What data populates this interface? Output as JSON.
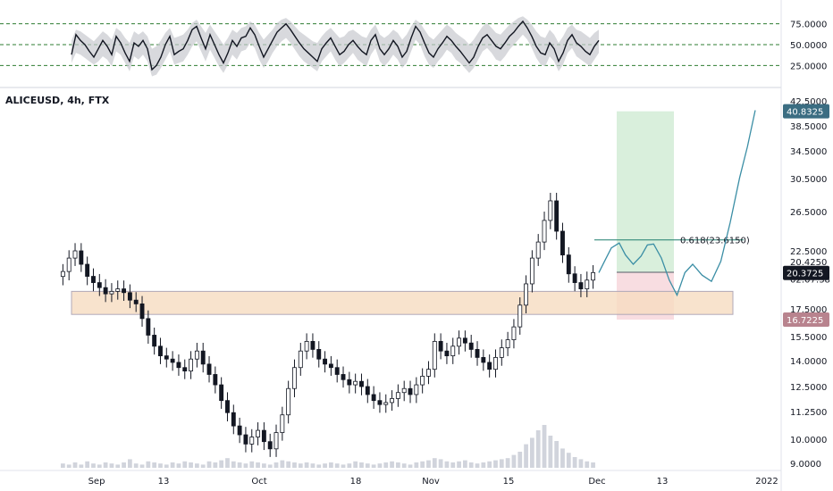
{
  "header": {
    "symbol_title": "ALICEUSD, 4h, FTX"
  },
  "colors": {
    "up_candle": "#131722",
    "volume": "#d1d4dc",
    "rsi_line": "#131722",
    "rsi_band": "#c7c9ce",
    "rsi_dash": "#2e7d32",
    "zone_fill": "#f6dcc0",
    "zone_stroke": "#b0a8b8",
    "target_fill": "#d9efdc",
    "stop_fill": "#f8dde1",
    "projection": "#3b8ea5",
    "fib_line": "#1f7f6e",
    "last_price_tag": "#131722",
    "target_tag": "#3b6d82",
    "stop_tag": "#b8838e"
  },
  "chart_data": [
    {
      "type": "line",
      "name": "rsi-pane",
      "y_ticks": [
        "75.0000",
        "50.0000",
        "25.0000"
      ],
      "y_tick_values": [
        75,
        50,
        25
      ],
      "ylim": [
        5,
        95
      ],
      "dashed_levels": [
        75,
        50,
        25
      ],
      "x": [
        0,
        5,
        10,
        15,
        20,
        25,
        30,
        35,
        40,
        45,
        50,
        55,
        60,
        65,
        70,
        75,
        80,
        85,
        90,
        95,
        100,
        105,
        110,
        115,
        120,
        125,
        130,
        135,
        140,
        145,
        150,
        155,
        160,
        165,
        170,
        175,
        180,
        185,
        190,
        195,
        200,
        205,
        210,
        215,
        220,
        225,
        230,
        235,
        240,
        245,
        250,
        255,
        260,
        265,
        270,
        275,
        280,
        285,
        290,
        295,
        300,
        305,
        310,
        315,
        320,
        325,
        330,
        335,
        340,
        345,
        350,
        355,
        360,
        365,
        370,
        375,
        380,
        385,
        390,
        395,
        400,
        405,
        410,
        415,
        420,
        425,
        430,
        435,
        440,
        445,
        450,
        455,
        460,
        465,
        470,
        475,
        480,
        485,
        490,
        495,
        500,
        505,
        510,
        515,
        520,
        525,
        530,
        535,
        540,
        545,
        550,
        555,
        560,
        565,
        570,
        575,
        580,
        585,
        590
      ],
      "values": [
        38,
        62,
        55,
        50,
        42,
        35,
        45,
        55,
        48,
        38,
        60,
        52,
        40,
        30,
        52,
        48,
        55,
        45,
        20,
        25,
        35,
        50,
        60,
        38,
        42,
        45,
        55,
        68,
        72,
        58,
        45,
        62,
        50,
        38,
        28,
        40,
        55,
        48,
        58,
        60,
        70,
        62,
        48,
        35,
        45,
        55,
        65,
        70,
        75,
        68,
        60,
        52,
        45,
        40,
        35,
        30,
        45,
        52,
        58,
        48,
        38,
        42,
        50,
        55,
        48,
        42,
        38,
        55,
        62,
        45,
        38,
        45,
        55,
        48,
        35,
        42,
        58,
        72,
        65,
        52,
        40,
        35,
        45,
        52,
        60,
        55,
        48,
        42,
        35,
        28,
        35,
        48,
        58,
        62,
        55,
        48,
        45,
        52,
        60,
        65,
        72,
        78,
        70,
        60,
        48,
        40,
        38,
        52,
        45,
        30,
        40,
        55,
        62,
        52,
        48,
        42,
        38,
        48,
        55
      ],
      "band_upper": [
        55,
        68,
        66,
        62,
        58,
        54,
        60,
        66,
        62,
        56,
        70,
        66,
        58,
        52,
        66,
        62,
        66,
        60,
        45,
        48,
        55,
        64,
        70,
        58,
        60,
        62,
        68,
        76,
        80,
        72,
        64,
        74,
        66,
        58,
        50,
        58,
        68,
        64,
        70,
        72,
        78,
        74,
        64,
        56,
        62,
        68,
        76,
        80,
        82,
        78,
        72,
        66,
        62,
        58,
        54,
        52,
        60,
        66,
        70,
        64,
        58,
        60,
        66,
        68,
        64,
        60,
        58,
        68,
        74,
        62,
        58,
        62,
        68,
        64,
        56,
        62,
        72,
        80,
        76,
        68,
        60,
        56,
        62,
        68,
        74,
        70,
        64,
        60,
        56,
        50,
        56,
        64,
        72,
        76,
        70,
        64,
        62,
        68,
        74,
        78,
        82,
        84,
        80,
        74,
        66,
        60,
        58,
        68,
        62,
        52,
        60,
        70,
        74,
        68,
        66,
        62,
        58,
        64,
        68
      ],
      "band_lower": [
        28,
        40,
        38,
        34,
        30,
        26,
        30,
        36,
        32,
        24,
        42,
        38,
        28,
        18,
        36,
        32,
        38,
        30,
        12,
        14,
        22,
        32,
        42,
        26,
        28,
        30,
        38,
        48,
        54,
        42,
        30,
        44,
        34,
        24,
        16,
        26,
        38,
        32,
        42,
        44,
        52,
        46,
        32,
        22,
        30,
        40,
        48,
        54,
        58,
        52,
        44,
        36,
        30,
        26,
        22,
        18,
        30,
        36,
        42,
        32,
        24,
        28,
        34,
        40,
        32,
        28,
        24,
        38,
        46,
        30,
        24,
        30,
        38,
        32,
        22,
        28,
        42,
        56,
        50,
        36,
        26,
        22,
        30,
        36,
        44,
        40,
        32,
        28,
        22,
        16,
        22,
        32,
        42,
        46,
        40,
        32,
        30,
        36,
        44,
        50,
        56,
        62,
        56,
        46,
        34,
        26,
        24,
        36,
        30,
        18,
        26,
        40,
        46,
        36,
        32,
        28,
        24,
        32,
        40
      ]
    },
    {
      "type": "candlestick",
      "name": "price-pane",
      "title": "ALICEUSD, 4h, FTX",
      "x_ticks": [
        "Sep",
        "13",
        "Oct",
        "18",
        "Nov",
        "15",
        "Dec",
        "13",
        "2022"
      ],
      "y_ticks": [
        "42.5000",
        "38.5000",
        "34.5000",
        "30.5000",
        "26.5000",
        "22.5000",
        "20.4250",
        "17.5000",
        "15.5000",
        "14.0000",
        "12.5000",
        "11.2500",
        "10.0000",
        "9.0000"
      ],
      "y_tick_values": [
        42.5,
        38.5,
        34.5,
        30.5,
        26.5,
        22.5,
        20.425,
        17.5,
        15.5,
        14,
        12.5,
        11.25,
        10,
        9
      ],
      "closes": [
        20.5,
        21.8,
        22.5,
        21.2,
        20.1,
        19.6,
        19.2,
        18.7,
        18.9,
        19.1,
        18.8,
        18.2,
        17.9,
        16.8,
        15.6,
        14.9,
        14.3,
        14.1,
        13.9,
        13.6,
        13.4,
        14.1,
        14.6,
        13.8,
        13.2,
        12.6,
        11.8,
        11.2,
        10.6,
        10.2,
        9.8,
        10.1,
        10.4,
        9.9,
        9.6,
        10.3,
        11.1,
        12.4,
        13.6,
        14.6,
        15.2,
        14.7,
        14.1,
        13.8,
        13.6,
        13.2,
        12.9,
        12.6,
        12.8,
        12.5,
        12.1,
        11.8,
        11.6,
        11.7,
        11.9,
        12.2,
        12.4,
        12.1,
        12.6,
        13.1,
        13.5,
        15.2,
        14.6,
        14.3,
        14.9,
        15.4,
        15.1,
        14.7,
        14.2,
        13.9,
        13.5,
        14.2,
        14.8,
        15.3,
        16.2,
        17.8,
        19.5,
        21.8,
        23.4,
        25.6,
        27.8,
        24.5,
        22.1,
        20.3,
        19.6,
        19.1,
        19.8,
        20.4
      ],
      "volumes": [
        4,
        3,
        5,
        3,
        6,
        4,
        3,
        5,
        4,
        3,
        5,
        8,
        4,
        3,
        6,
        5,
        4,
        3,
        5,
        4,
        6,
        5,
        4,
        3,
        6,
        5,
        7,
        9,
        6,
        5,
        4,
        6,
        5,
        4,
        3,
        5,
        7,
        6,
        5,
        4,
        5,
        4,
        3,
        4,
        5,
        4,
        3,
        4,
        6,
        5,
        4,
        3,
        4,
        5,
        6,
        5,
        4,
        3,
        5,
        6,
        7,
        9,
        8,
        6,
        5,
        6,
        7,
        5,
        4,
        5,
        6,
        7,
        8,
        9,
        12,
        15,
        22,
        28,
        35,
        40,
        30,
        25,
        18,
        14,
        10,
        8,
        6,
        5
      ],
      "support_zone": [
        17.1,
        18.9
      ],
      "long_position": {
        "entry": 20.425,
        "target": 40.8325,
        "stop": 16.7225
      },
      "fib_label": "0.618(23.6150)",
      "fib_value": 23.615,
      "projection_x": [
        0,
        0.04,
        0.08,
        0.13,
        0.17,
        0.22,
        0.27,
        0.31,
        0.35,
        0.4,
        0.45,
        0.5,
        0.55,
        0.6,
        0.66,
        0.72,
        0.78,
        0.84,
        0.9,
        0.95,
        1.0
      ],
      "projection_y": [
        20.4,
        21.6,
        22.8,
        23.3,
        22.1,
        21.2,
        22.0,
        23.1,
        23.2,
        21.8,
        19.8,
        18.6,
        20.4,
        21.2,
        20.2,
        19.7,
        21.5,
        25.4,
        30.6,
        35.2,
        41.0
      ],
      "price_tags": {
        "target": "40.8325",
        "entry": "20.4250",
        "countdown": "02:07:38",
        "last": "20.3725",
        "stop": "16.7225"
      }
    }
  ]
}
